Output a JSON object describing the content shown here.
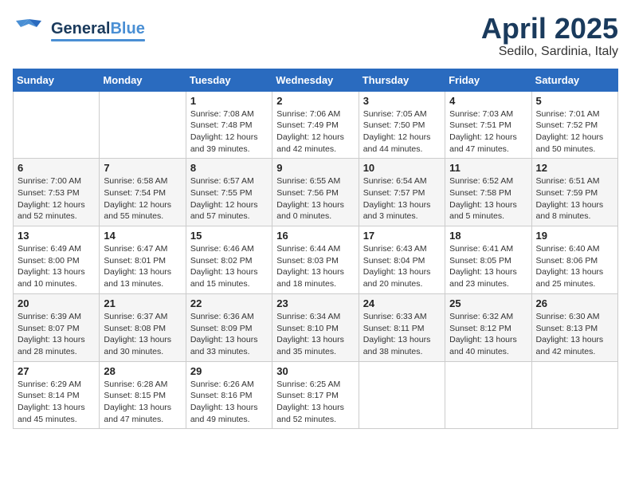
{
  "header": {
    "logo_general": "General",
    "logo_blue": "Blue",
    "month_title": "April 2025",
    "location": "Sedilo, Sardinia, Italy"
  },
  "weekdays": [
    "Sunday",
    "Monday",
    "Tuesday",
    "Wednesday",
    "Thursday",
    "Friday",
    "Saturday"
  ],
  "weeks": [
    [
      {
        "day": "",
        "info": ""
      },
      {
        "day": "",
        "info": ""
      },
      {
        "day": "1",
        "info": "Sunrise: 7:08 AM\nSunset: 7:48 PM\nDaylight: 12 hours\nand 39 minutes."
      },
      {
        "day": "2",
        "info": "Sunrise: 7:06 AM\nSunset: 7:49 PM\nDaylight: 12 hours\nand 42 minutes."
      },
      {
        "day": "3",
        "info": "Sunrise: 7:05 AM\nSunset: 7:50 PM\nDaylight: 12 hours\nand 44 minutes."
      },
      {
        "day": "4",
        "info": "Sunrise: 7:03 AM\nSunset: 7:51 PM\nDaylight: 12 hours\nand 47 minutes."
      },
      {
        "day": "5",
        "info": "Sunrise: 7:01 AM\nSunset: 7:52 PM\nDaylight: 12 hours\nand 50 minutes."
      }
    ],
    [
      {
        "day": "6",
        "info": "Sunrise: 7:00 AM\nSunset: 7:53 PM\nDaylight: 12 hours\nand 52 minutes."
      },
      {
        "day": "7",
        "info": "Sunrise: 6:58 AM\nSunset: 7:54 PM\nDaylight: 12 hours\nand 55 minutes."
      },
      {
        "day": "8",
        "info": "Sunrise: 6:57 AM\nSunset: 7:55 PM\nDaylight: 12 hours\nand 57 minutes."
      },
      {
        "day": "9",
        "info": "Sunrise: 6:55 AM\nSunset: 7:56 PM\nDaylight: 13 hours\nand 0 minutes."
      },
      {
        "day": "10",
        "info": "Sunrise: 6:54 AM\nSunset: 7:57 PM\nDaylight: 13 hours\nand 3 minutes."
      },
      {
        "day": "11",
        "info": "Sunrise: 6:52 AM\nSunset: 7:58 PM\nDaylight: 13 hours\nand 5 minutes."
      },
      {
        "day": "12",
        "info": "Sunrise: 6:51 AM\nSunset: 7:59 PM\nDaylight: 13 hours\nand 8 minutes."
      }
    ],
    [
      {
        "day": "13",
        "info": "Sunrise: 6:49 AM\nSunset: 8:00 PM\nDaylight: 13 hours\nand 10 minutes."
      },
      {
        "day": "14",
        "info": "Sunrise: 6:47 AM\nSunset: 8:01 PM\nDaylight: 13 hours\nand 13 minutes."
      },
      {
        "day": "15",
        "info": "Sunrise: 6:46 AM\nSunset: 8:02 PM\nDaylight: 13 hours\nand 15 minutes."
      },
      {
        "day": "16",
        "info": "Sunrise: 6:44 AM\nSunset: 8:03 PM\nDaylight: 13 hours\nand 18 minutes."
      },
      {
        "day": "17",
        "info": "Sunrise: 6:43 AM\nSunset: 8:04 PM\nDaylight: 13 hours\nand 20 minutes."
      },
      {
        "day": "18",
        "info": "Sunrise: 6:41 AM\nSunset: 8:05 PM\nDaylight: 13 hours\nand 23 minutes."
      },
      {
        "day": "19",
        "info": "Sunrise: 6:40 AM\nSunset: 8:06 PM\nDaylight: 13 hours\nand 25 minutes."
      }
    ],
    [
      {
        "day": "20",
        "info": "Sunrise: 6:39 AM\nSunset: 8:07 PM\nDaylight: 13 hours\nand 28 minutes."
      },
      {
        "day": "21",
        "info": "Sunrise: 6:37 AM\nSunset: 8:08 PM\nDaylight: 13 hours\nand 30 minutes."
      },
      {
        "day": "22",
        "info": "Sunrise: 6:36 AM\nSunset: 8:09 PM\nDaylight: 13 hours\nand 33 minutes."
      },
      {
        "day": "23",
        "info": "Sunrise: 6:34 AM\nSunset: 8:10 PM\nDaylight: 13 hours\nand 35 minutes."
      },
      {
        "day": "24",
        "info": "Sunrise: 6:33 AM\nSunset: 8:11 PM\nDaylight: 13 hours\nand 38 minutes."
      },
      {
        "day": "25",
        "info": "Sunrise: 6:32 AM\nSunset: 8:12 PM\nDaylight: 13 hours\nand 40 minutes."
      },
      {
        "day": "26",
        "info": "Sunrise: 6:30 AM\nSunset: 8:13 PM\nDaylight: 13 hours\nand 42 minutes."
      }
    ],
    [
      {
        "day": "27",
        "info": "Sunrise: 6:29 AM\nSunset: 8:14 PM\nDaylight: 13 hours\nand 45 minutes."
      },
      {
        "day": "28",
        "info": "Sunrise: 6:28 AM\nSunset: 8:15 PM\nDaylight: 13 hours\nand 47 minutes."
      },
      {
        "day": "29",
        "info": "Sunrise: 6:26 AM\nSunset: 8:16 PM\nDaylight: 13 hours\nand 49 minutes."
      },
      {
        "day": "30",
        "info": "Sunrise: 6:25 AM\nSunset: 8:17 PM\nDaylight: 13 hours\nand 52 minutes."
      },
      {
        "day": "",
        "info": ""
      },
      {
        "day": "",
        "info": ""
      },
      {
        "day": "",
        "info": ""
      }
    ]
  ]
}
